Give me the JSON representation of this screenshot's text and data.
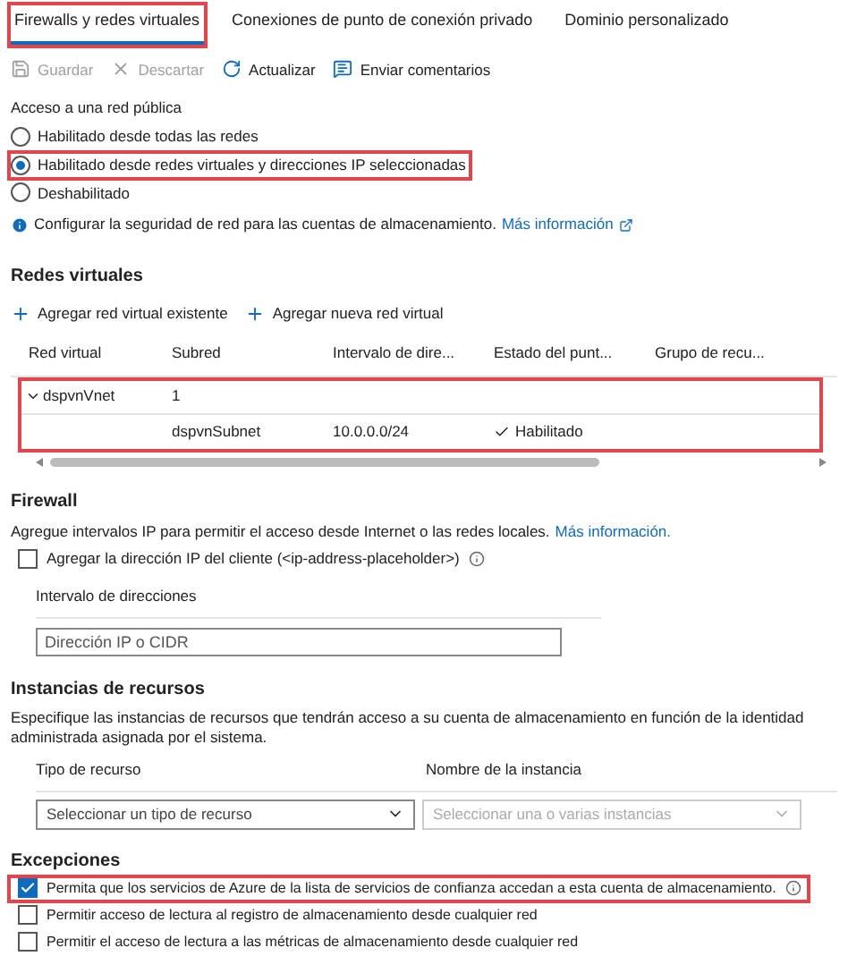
{
  "tabs": [
    {
      "label": "Firewalls y redes virtuales",
      "selected": true,
      "highlighted": true
    },
    {
      "label": "Conexiones de punto de conexión privado",
      "selected": false,
      "highlighted": false
    },
    {
      "label": "Dominio personalizado",
      "selected": false,
      "highlighted": false
    }
  ],
  "toolbar": [
    {
      "kind": "save",
      "label": "Guardar",
      "disabled": true
    },
    {
      "kind": "discard",
      "label": "Descartar",
      "disabled": true
    },
    {
      "kind": "refresh",
      "label": "Actualizar",
      "disabled": false
    },
    {
      "kind": "feedback",
      "label": "Enviar comentarios",
      "disabled": false
    }
  ],
  "public_access": {
    "label": "Acceso a una red pública",
    "options": [
      {
        "label": "Habilitado desde todas las redes",
        "selected": false,
        "highlighted": false
      },
      {
        "label": "Habilitado desde redes virtuales y direcciones IP seleccionadas",
        "selected": true,
        "highlighted": true
      },
      {
        "label": "Deshabilitado",
        "selected": false,
        "highlighted": false
      }
    ]
  },
  "info": {
    "text": "Configurar la seguridad de red para las cuentas de almacenamiento.",
    "link": "Más información"
  },
  "virtual_networks": {
    "title": "Redes virtuales",
    "actions": [
      "Agregar red virtual existente",
      "Agregar nueva red virtual"
    ],
    "columns": [
      "Red virtual",
      "Subred",
      "Intervalo de dire...",
      "Estado del punt...",
      "Grupo de recu..."
    ],
    "highlighted": true,
    "rows": [
      {
        "name": "dspvnVnet",
        "expanded": true,
        "count": "1",
        "children": [
          {
            "subnet": "dspvnSubnet",
            "range": "10.0.0.0/24",
            "status": "Habilitado"
          }
        ]
      }
    ]
  },
  "firewall": {
    "title": "Firewall",
    "description": "Agregue intervalos IP para permitir el acceso desde Internet o las redes locales.",
    "link": "Más información.",
    "client_ip": {
      "label": "Agregar la dirección IP del cliente (<ip-address-placeholder>)",
      "checked": false
    },
    "range_label": "Intervalo de direcciones",
    "range_placeholder": "Dirección IP o CIDR"
  },
  "resource_instances": {
    "title": "Instancias de recursos",
    "description": "Especifique las instancias de recursos que tendrán acceso a su cuenta de almacenamiento en función de la identidad administrada asignada por el sistema.",
    "type_label": "Tipo de recurso",
    "type_placeholder": "Seleccionar un tipo de recurso",
    "instance_label": "Nombre de la instancia",
    "instance_placeholder": "Seleccionar una o varias instancias",
    "instance_disabled": true
  },
  "exceptions": {
    "title": "Excepciones",
    "items": [
      {
        "label": "Permita que los servicios de Azure de la lista de servicios de confianza accedan a esta cuenta de almacenamiento.",
        "checked": true,
        "highlighted": true,
        "info": true
      },
      {
        "label": "Permitir acceso de lectura al registro de almacenamiento desde cualquier red",
        "checked": false,
        "highlighted": false,
        "info": false
      },
      {
        "label": "Permitir el acceso de lectura a las métricas de almacenamiento desde cualquier red",
        "checked": false,
        "highlighted": false,
        "info": false
      }
    ]
  }
}
